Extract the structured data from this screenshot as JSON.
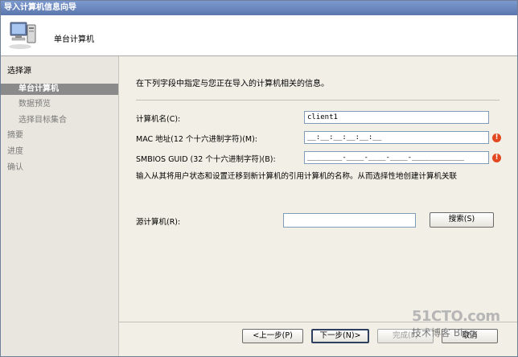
{
  "window": {
    "title": "导入计算机信息向导"
  },
  "header": {
    "title": "单台计算机",
    "icon": "computer-icon"
  },
  "sidebar": {
    "items": [
      {
        "label": "选择源",
        "state": "normal"
      },
      {
        "label": "单台计算机",
        "state": "active"
      },
      {
        "label": "数据预览",
        "state": "muted"
      },
      {
        "label": "选择目标集合",
        "state": "muted"
      },
      {
        "label": "摘要",
        "state": "muted"
      },
      {
        "label": "进度",
        "state": "muted"
      },
      {
        "label": "确认",
        "state": "muted"
      }
    ]
  },
  "main": {
    "intro": "在下列字段中指定与您正在导入的计算机相关的信息。",
    "computer_name": {
      "label": "计算机名(C):",
      "value": "client1"
    },
    "mac": {
      "label": "MAC 地址(12 个十六进制字符)(M):",
      "value": "__:__:__:__:__:__",
      "error_icon": "error-icon"
    },
    "smbios": {
      "label": "SMBIOS GUID (32 个十六进制字符)(B):",
      "value": "________-____-____-____-____________",
      "error_icon": "error-icon"
    },
    "note": "输入从其将用户状态和设置迁移到新计算机的引用计算机的名称。从而选择性地创建计算机关联",
    "source_computer": {
      "label": "源计算机(R):",
      "value": ""
    },
    "search_button": "搜索(S)"
  },
  "footer": {
    "back": "<上一步(P)",
    "next": "下一步(N)>",
    "finish": "完成(F)",
    "cancel": "取消"
  },
  "watermark": {
    "top": "51CTO.com",
    "bottom": "技术博客 Blog"
  },
  "colors": {
    "titlebar": "#5b76ad",
    "active_item": "#8a8a8a",
    "error": "#e2471f"
  }
}
